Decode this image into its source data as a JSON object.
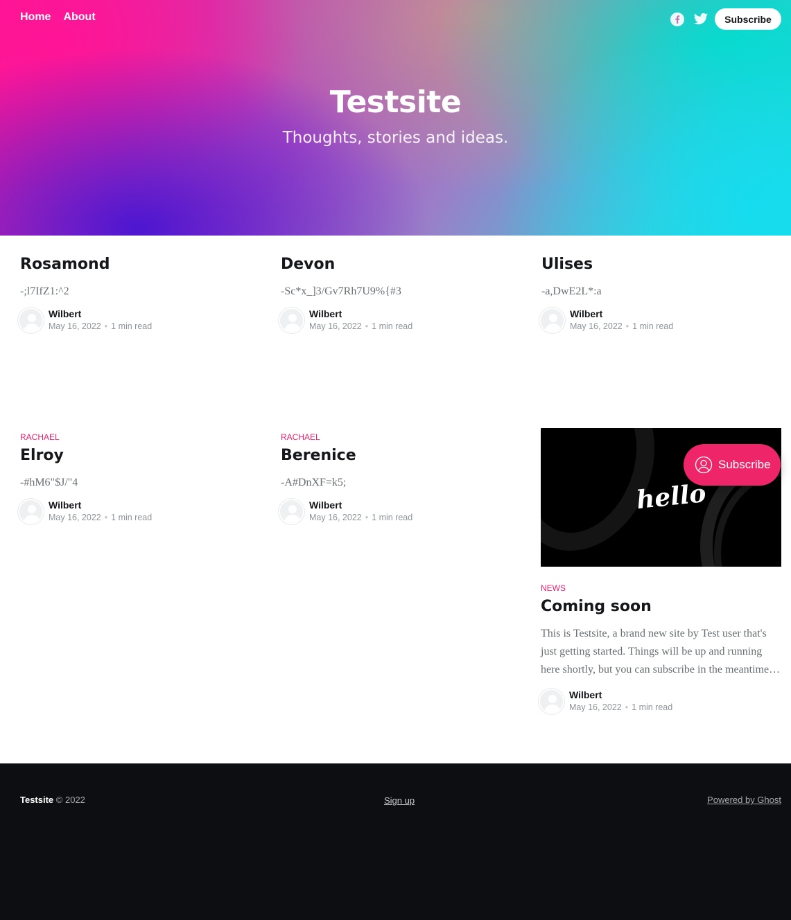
{
  "header": {
    "nav": [
      {
        "label": "Home"
      },
      {
        "label": "About"
      }
    ],
    "social_icons": [
      "facebook-icon",
      "twitter-icon"
    ],
    "subscribe_label": "Subscribe",
    "site_title": "Testsite",
    "site_description": "Thoughts, stories and ideas."
  },
  "posts": [
    {
      "tag": "",
      "title": "Rosamond",
      "excerpt": "-;l7IfZ1:^2",
      "author": "Wilbert",
      "date": "May 16, 2022",
      "read_time": "1 min read"
    },
    {
      "tag": "",
      "title": "Devon",
      "excerpt": "-Sc*x_]3/Gv7Rh7U9%{#3",
      "author": "Wilbert",
      "date": "May 16, 2022",
      "read_time": "1 min read"
    },
    {
      "tag": "",
      "title": "Ulises",
      "excerpt": "-a,DwE2L*:a",
      "author": "Wilbert",
      "date": "May 16, 2022",
      "read_time": "1 min read"
    },
    {
      "tag": "Rachael",
      "title": "Elroy",
      "excerpt": "-#hM6\"$J/\"4",
      "author": "Wilbert",
      "date": "May 16, 2022",
      "read_time": "1 min read"
    },
    {
      "tag": "Rachael",
      "title": "Berenice",
      "excerpt": "-A#DnXF=k5;",
      "author": "Wilbert",
      "date": "May 16, 2022",
      "read_time": "1 min read"
    },
    {
      "tag": "News",
      "title": "Coming soon",
      "excerpt": "This is Testsite, a brand new site by Test user that's just getting started. Things will be up and running here shortly, but you can subscribe in the meantime…",
      "author": "Wilbert",
      "date": "May 16, 2022",
      "read_time": "1 min read",
      "image_text": "hello"
    }
  ],
  "floating_subscribe": {
    "label": "Subscribe",
    "icon": "user-circle-icon"
  },
  "footer": {
    "site_name": "Testsite",
    "copyright": "© 2022",
    "signup": "Sign up",
    "powered": "Powered by Ghost"
  },
  "colors": {
    "accent": "#ec1f6e",
    "footer_bg": "#0c0e11",
    "floating_button": "#ee2569"
  }
}
